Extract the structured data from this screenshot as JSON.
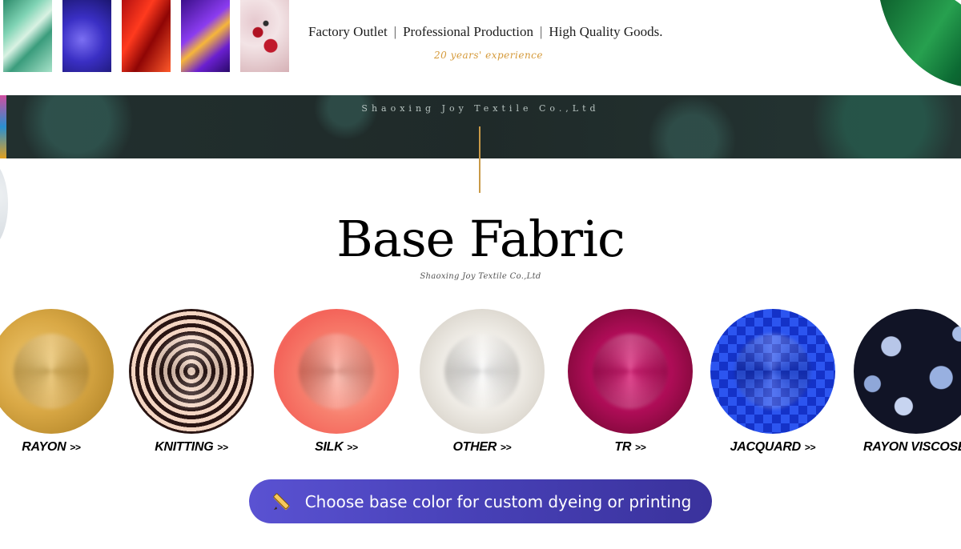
{
  "header": {
    "thumbnails": [
      "green-floral-print",
      "blue-satin",
      "red-floral-print",
      "purple-floral-print",
      "pink-red-print"
    ],
    "tagline": [
      "Factory Outlet",
      "Professional Production",
      "High Quality Goods."
    ],
    "tagline_separator": "|",
    "experience": "20 years' experience"
  },
  "banner": {
    "company": "Shaoxing Joy Textile Co.,Ltd"
  },
  "section": {
    "title": "Base Fabric",
    "subtitle": "Shaoxing Joy Textile Co.,Ltd"
  },
  "fabrics": [
    {
      "label": "RAYON",
      "arrow": ">>"
    },
    {
      "label": "KNITTING",
      "arrow": ">>"
    },
    {
      "label": "SILK",
      "arrow": ">>"
    },
    {
      "label": "OTHER",
      "arrow": ">>"
    },
    {
      "label": "TR",
      "arrow": ">>"
    },
    {
      "label": "JACQUARD",
      "arrow": ">>"
    },
    {
      "label": "RAYON VISCOSE",
      "arrow": ""
    }
  ],
  "cta": {
    "label": "Choose base color for custom dyeing or printing",
    "icon": "pencil-ruler-icon"
  },
  "colors": {
    "accent_gold": "#c99a48",
    "cta_purple": "#4740b6",
    "banner_dark": "#1f2a29"
  }
}
